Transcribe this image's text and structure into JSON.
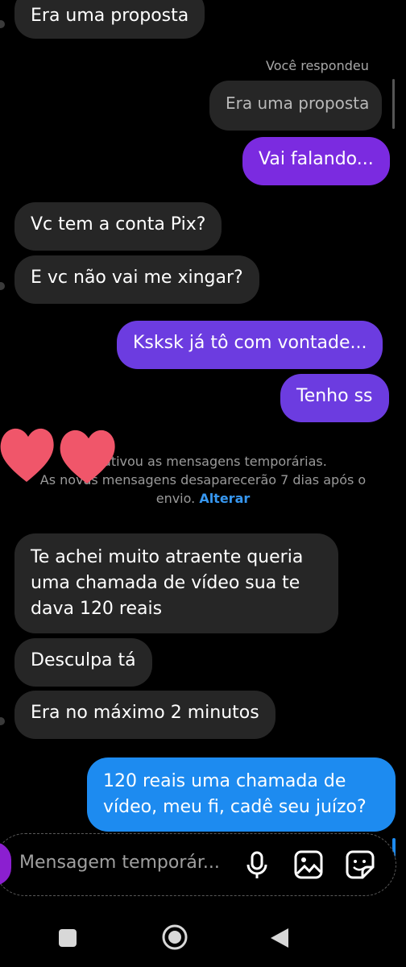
{
  "thread": {
    "reply_header": "Você respondeu",
    "messages": [
      {
        "text": "Era uma proposta"
      },
      {
        "text": "Era uma proposta"
      },
      {
        "text": "Vai falando..."
      },
      {
        "text": "Vc tem a conta Pix?"
      },
      {
        "text": "E vc não vai me xingar?"
      },
      {
        "text": "Ksksk já tô com vontade..."
      },
      {
        "text": "Tenho ss"
      },
      {
        "text": [
          "Te achei muito atraente queria",
          "uma chamada de vídeo sua te",
          "dava 120 reais"
        ]
      },
      {
        "text": "Desculpa tá"
      },
      {
        "text": "Era no máximo 2 minutos"
      },
      {
        "text": [
          "120 reais uma chamada de",
          "vídeo, meu fi, cadê seu juízo?"
        ]
      }
    ],
    "notice": {
      "line1": "uí...ativou as mensagens temporárias.",
      "line2": "As novas mensagens desaparecerão 7 dias após o",
      "line3_prefix": "envio.",
      "link": "Alterar"
    }
  },
  "composer": {
    "placeholder": "Mensagem temporár..."
  },
  "colors": {
    "sent_purple": "#7b2be0",
    "sent_violet": "#6c3ce0",
    "sent_blue": "#1d8bf0",
    "received": "#262626",
    "link": "#3797f0"
  },
  "icons": [
    "microphone-icon",
    "image-icon",
    "sticker-icon",
    "square-nav-icon",
    "circle-nav-icon",
    "back-triangle-icon",
    "heart-sticker"
  ]
}
